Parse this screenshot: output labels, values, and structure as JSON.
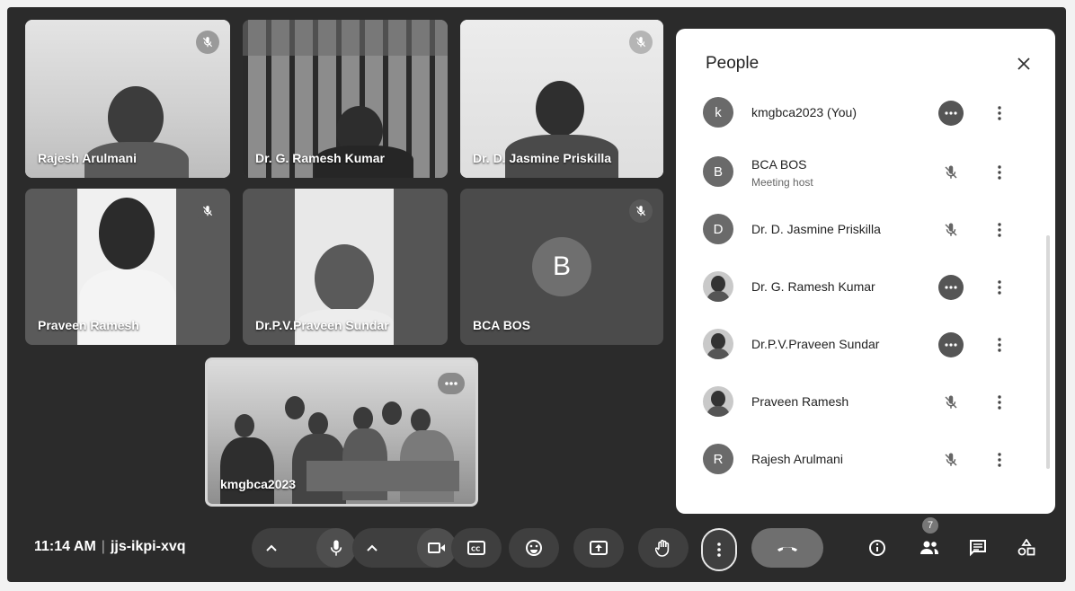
{
  "tiles": [
    {
      "name": "Rajesh Arulmani",
      "muted": true
    },
    {
      "name": "Dr. G. Ramesh Kumar",
      "muted": false
    },
    {
      "name": "Dr. D. Jasmine Priskilla",
      "muted": true
    },
    {
      "name": "Praveen Ramesh",
      "muted": true
    },
    {
      "name": "Dr.P.V.Praveen Sundar",
      "muted": false
    },
    {
      "name": "BCA BOS",
      "muted": true,
      "initial": "B"
    },
    {
      "name": "kmgbca2023",
      "muted": false
    }
  ],
  "panel": {
    "title": "People",
    "participants": [
      {
        "initial": "k",
        "name": "kmgbca2023 (You)",
        "sub": "",
        "state": "speaking"
      },
      {
        "initial": "B",
        "name": "BCA BOS",
        "sub": "Meeting host",
        "state": "muted"
      },
      {
        "initial": "D",
        "name": "Dr. D. Jasmine Priskilla",
        "sub": "",
        "state": "muted"
      },
      {
        "initial": "",
        "name": "Dr. G. Ramesh Kumar",
        "sub": "",
        "state": "speaking"
      },
      {
        "initial": "",
        "name": "Dr.P.V.Praveen Sundar",
        "sub": "",
        "state": "speaking"
      },
      {
        "initial": "",
        "name": "Praveen Ramesh",
        "sub": "",
        "state": "muted"
      },
      {
        "initial": "R",
        "name": "Rajesh Arulmani",
        "sub": "",
        "state": "muted"
      }
    ]
  },
  "meeting": {
    "time": "11:14 AM",
    "separator": "|",
    "code": "jjs-ikpi-xvq"
  },
  "people_count": "7",
  "icons": {
    "mic": "mic-icon",
    "camera": "camera-icon",
    "captions": "captions-icon",
    "emoji": "emoji-icon",
    "present": "present-icon",
    "hand": "raise-hand-icon",
    "more": "more-vert-icon",
    "end": "end-call-icon",
    "info": "info-icon",
    "people": "people-icon",
    "chat": "chat-icon",
    "activities": "activities-icon"
  }
}
